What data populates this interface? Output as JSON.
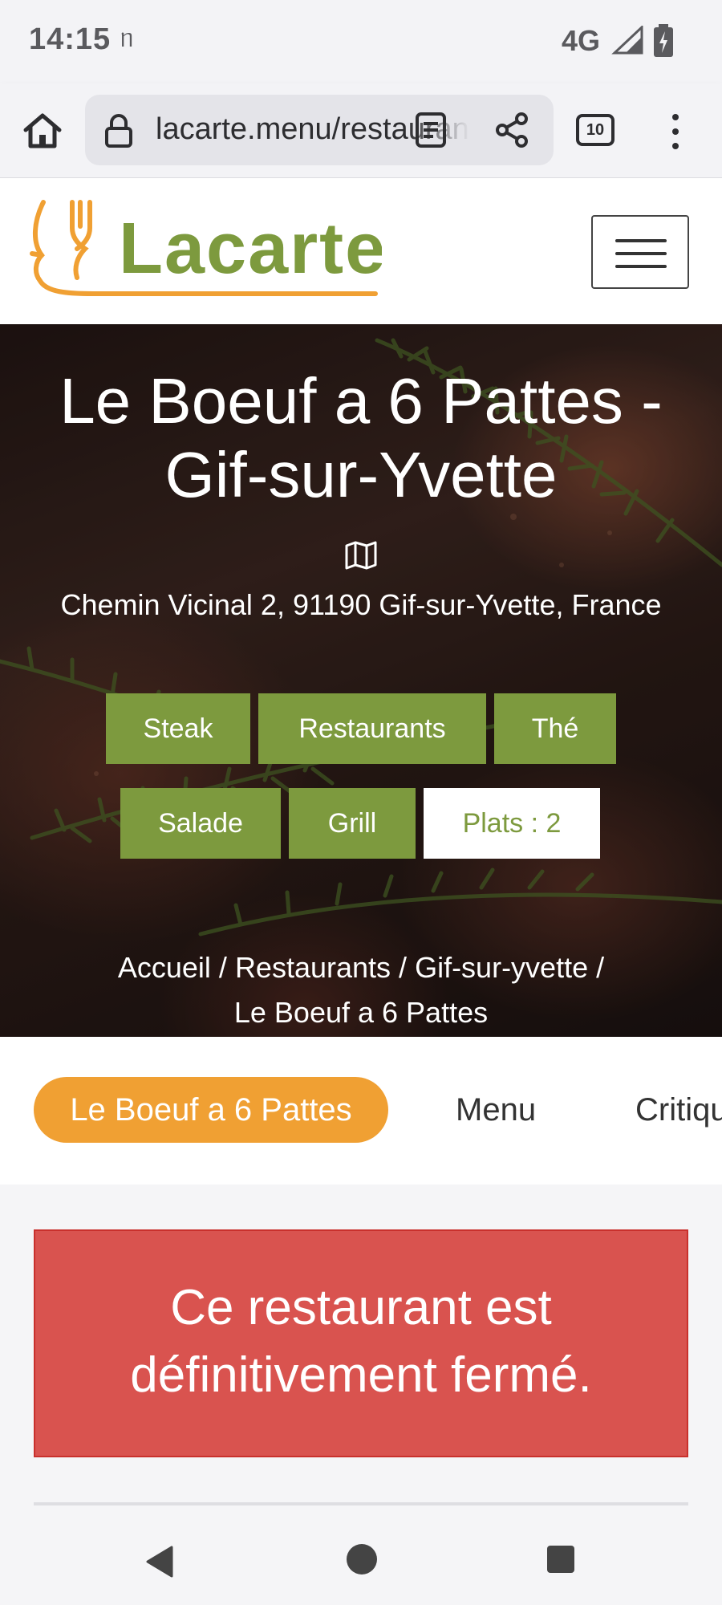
{
  "status_bar": {
    "time": "14:15",
    "extra": "ᥒ",
    "network": "4G"
  },
  "browser": {
    "url": "lacarte.menu/restaurants/gif-sur-yvette",
    "tab_count": "10"
  },
  "site": {
    "logo_text": "Lacarte",
    "brand_green": "#7d9a3e",
    "brand_orange": "#f0a033"
  },
  "hero": {
    "title": "Le Boeuf a 6 Pattes - Gif-sur-Yvette",
    "address": "Chemin Vicinal 2, 91190 Gif-sur-Yvette, France",
    "tags": [
      "Steak",
      "Restaurants",
      "Thé",
      "Salade",
      "Grill"
    ],
    "plats_label": "Plats : 2",
    "breadcrumb": [
      "Accueil",
      "Restaurants",
      "Gif-sur-yvette",
      "Le Boeuf a 6 Pattes"
    ]
  },
  "tabs": {
    "active": "Le Boeuf a 6 Pattes",
    "menu": "Menu",
    "reviews": "Critiques"
  },
  "notice": {
    "text": "Ce restaurant est définitivement fermé.",
    "color": "#d9534f"
  }
}
